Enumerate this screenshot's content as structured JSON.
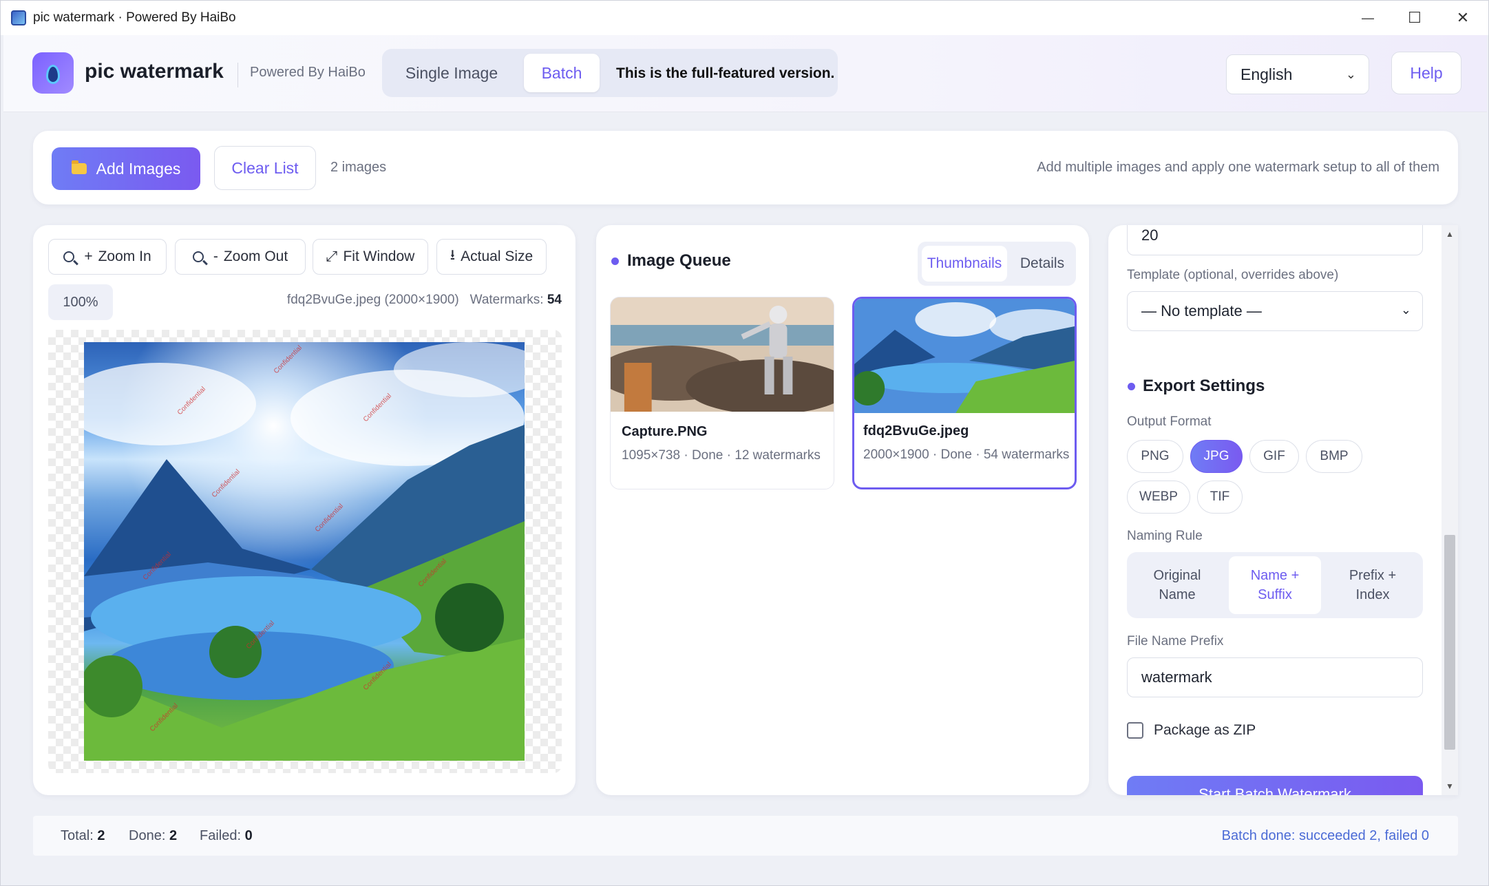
{
  "window": {
    "title": "pic watermark · Powered By HaiBo",
    "controls": {
      "minimize": "—",
      "maximize": "☐",
      "close": "✕"
    }
  },
  "header": {
    "brand": "pic watermark",
    "powered": "Powered By HaiBo",
    "modes": {
      "single": "Single Image",
      "batch": "Batch"
    },
    "note": "This is the full-featured version.",
    "language": "English",
    "help": "Help"
  },
  "toolbar": {
    "add_label": "Add Images",
    "clear_label": "Clear List",
    "count": "2 images",
    "hint": "Add multiple images and apply one watermark setup to all of them"
  },
  "preview": {
    "zoom_in": "Zoom In",
    "zoom_out": "Zoom Out",
    "fit_window": "Fit Window",
    "actual_size": "Actual Size",
    "zoom_level": "100%",
    "file_info": "fdq2BvuGe.jpeg (2000×1900)",
    "watermarks_label": "Watermarks:",
    "watermarks_count": "54",
    "watermark_text": "Confidential"
  },
  "queue": {
    "title": "Image Queue",
    "tabs": {
      "thumbnails": "Thumbnails",
      "details": "Details"
    },
    "items": [
      {
        "name": "Capture.PNG",
        "info": "1095×738 · Done · 12 watermarks"
      },
      {
        "name": "fdq2BvuGe.jpeg",
        "info": "2000×1900 · Done · 54 watermarks"
      }
    ]
  },
  "settings": {
    "partial_value": "20",
    "template_label": "Template (optional, overrides above)",
    "template_value": "— No template —",
    "export_title": "Export Settings",
    "output_format_label": "Output Format",
    "formats": [
      "PNG",
      "JPG",
      "GIF",
      "BMP",
      "WEBP",
      "TIF"
    ],
    "selected_format": "JPG",
    "naming_label": "Naming Rule",
    "naming_options": [
      "Original Name",
      "Name + Suffix",
      "Prefix + Index"
    ],
    "selected_naming": "Name + Suffix",
    "prefix_label": "File Name Prefix",
    "prefix_value": "watermark",
    "zip_label": "Package as ZIP",
    "start_label": "Start Batch Watermark"
  },
  "status": {
    "total_label": "Total:",
    "total": "2",
    "done_label": "Done:",
    "done": "2",
    "failed_label": "Failed:",
    "failed": "0",
    "message": "Batch done: succeeded 2, failed 0"
  },
  "colors": {
    "accent": "#6d5cf0",
    "status_blue": "#4b6bd6"
  }
}
